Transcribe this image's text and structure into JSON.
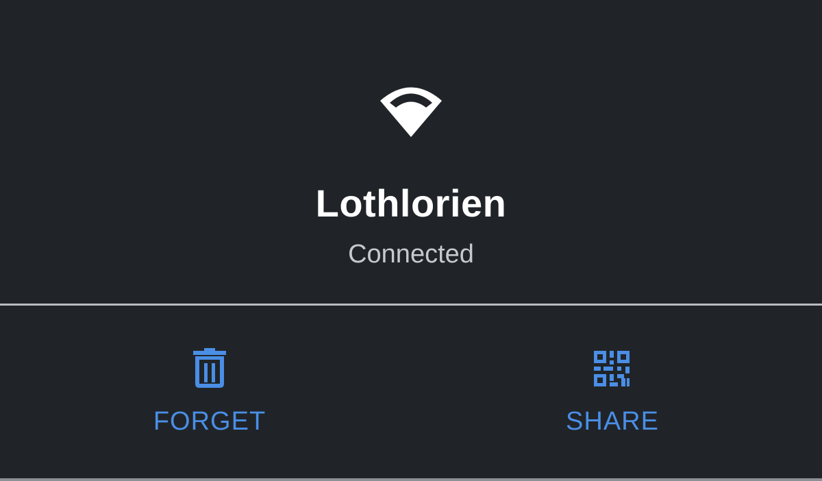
{
  "network": {
    "name": "Lothlorien",
    "status": "Connected",
    "icon": "wifi-signal-icon"
  },
  "actions": {
    "forget": {
      "label": "FORGET",
      "icon": "trash-icon"
    },
    "share": {
      "label": "SHARE",
      "icon": "qr-code-icon"
    }
  },
  "colors": {
    "background": "#202428",
    "accent": "#4a8ee6",
    "title": "#ffffff",
    "status": "#c7c9cc",
    "divider": "#b9bcbf"
  }
}
